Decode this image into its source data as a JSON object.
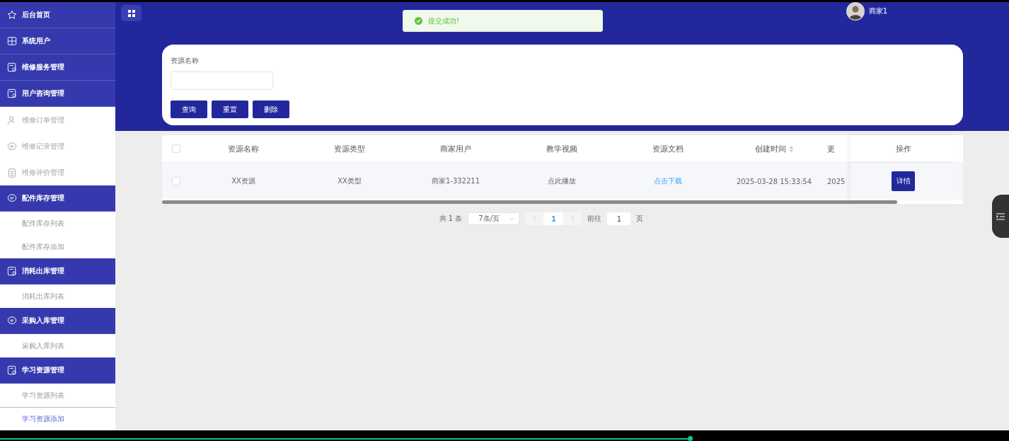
{
  "sidebar": {
    "items": [
      {
        "label": "后台首页",
        "kind": "top"
      },
      {
        "label": "系统用户",
        "kind": "top"
      },
      {
        "label": "维修服务管理",
        "kind": "top"
      },
      {
        "label": "用户咨询管理",
        "kind": "top"
      },
      {
        "label": "维修订单管理",
        "kind": "plain"
      },
      {
        "label": "维修记录管理",
        "kind": "plain"
      },
      {
        "label": "维修评价管理",
        "kind": "plain"
      },
      {
        "label": "配件库存管理",
        "kind": "group",
        "children": [
          {
            "label": "配件库存列表",
            "selected": false
          },
          {
            "label": "配件库存添加",
            "selected": false
          }
        ]
      },
      {
        "label": "消耗出库管理",
        "kind": "group",
        "children": [
          {
            "label": "消耗出库列表",
            "selected": false
          }
        ]
      },
      {
        "label": "采购入库管理",
        "kind": "group",
        "children": [
          {
            "label": "采购入库列表",
            "selected": false
          }
        ]
      },
      {
        "label": "学习资源管理",
        "kind": "group",
        "children": [
          {
            "label": "学习资源列表",
            "selected": false
          },
          {
            "label": "学习资源添加",
            "selected": true
          }
        ]
      }
    ]
  },
  "header": {
    "user": "商家1"
  },
  "toast": {
    "message": "提交成功!"
  },
  "search": {
    "label": "资源名称",
    "buttons": [
      "查询",
      "重置",
      "删除"
    ]
  },
  "table": {
    "select_all": {
      "checked": false
    },
    "columns": [
      {
        "label": "资源名称",
        "kind": "text",
        "sortable": false
      },
      {
        "label": "资源类型",
        "kind": "text",
        "sortable": false
      },
      {
        "label": "商家用户",
        "kind": "text",
        "sortable": false
      },
      {
        "label": "教学视频",
        "kind": "text",
        "sortable": false
      },
      {
        "label": "资源文档",
        "kind": "link",
        "sortable": false
      },
      {
        "label": "创建时间",
        "kind": "text",
        "sortable": true
      },
      {
        "label": "更",
        "kind": "cut",
        "sortable": false
      }
    ],
    "action_column": "操作",
    "rows": [
      {
        "checked": false,
        "cells": [
          "XX资源",
          "XX类型",
          "商家1-332211",
          "点此播放",
          "点击下载",
          "2025-03-28 15:33:54",
          "2025"
        ],
        "action": "详情"
      }
    ]
  },
  "pagination": {
    "total": "共 1 条",
    "page_size": "7条/页",
    "pages": [
      {
        "label": "1",
        "selected": true
      }
    ],
    "goto_label": "前往",
    "goto_value": "1",
    "goto_suffix": "页"
  },
  "player": {
    "level": 0.684
  }
}
